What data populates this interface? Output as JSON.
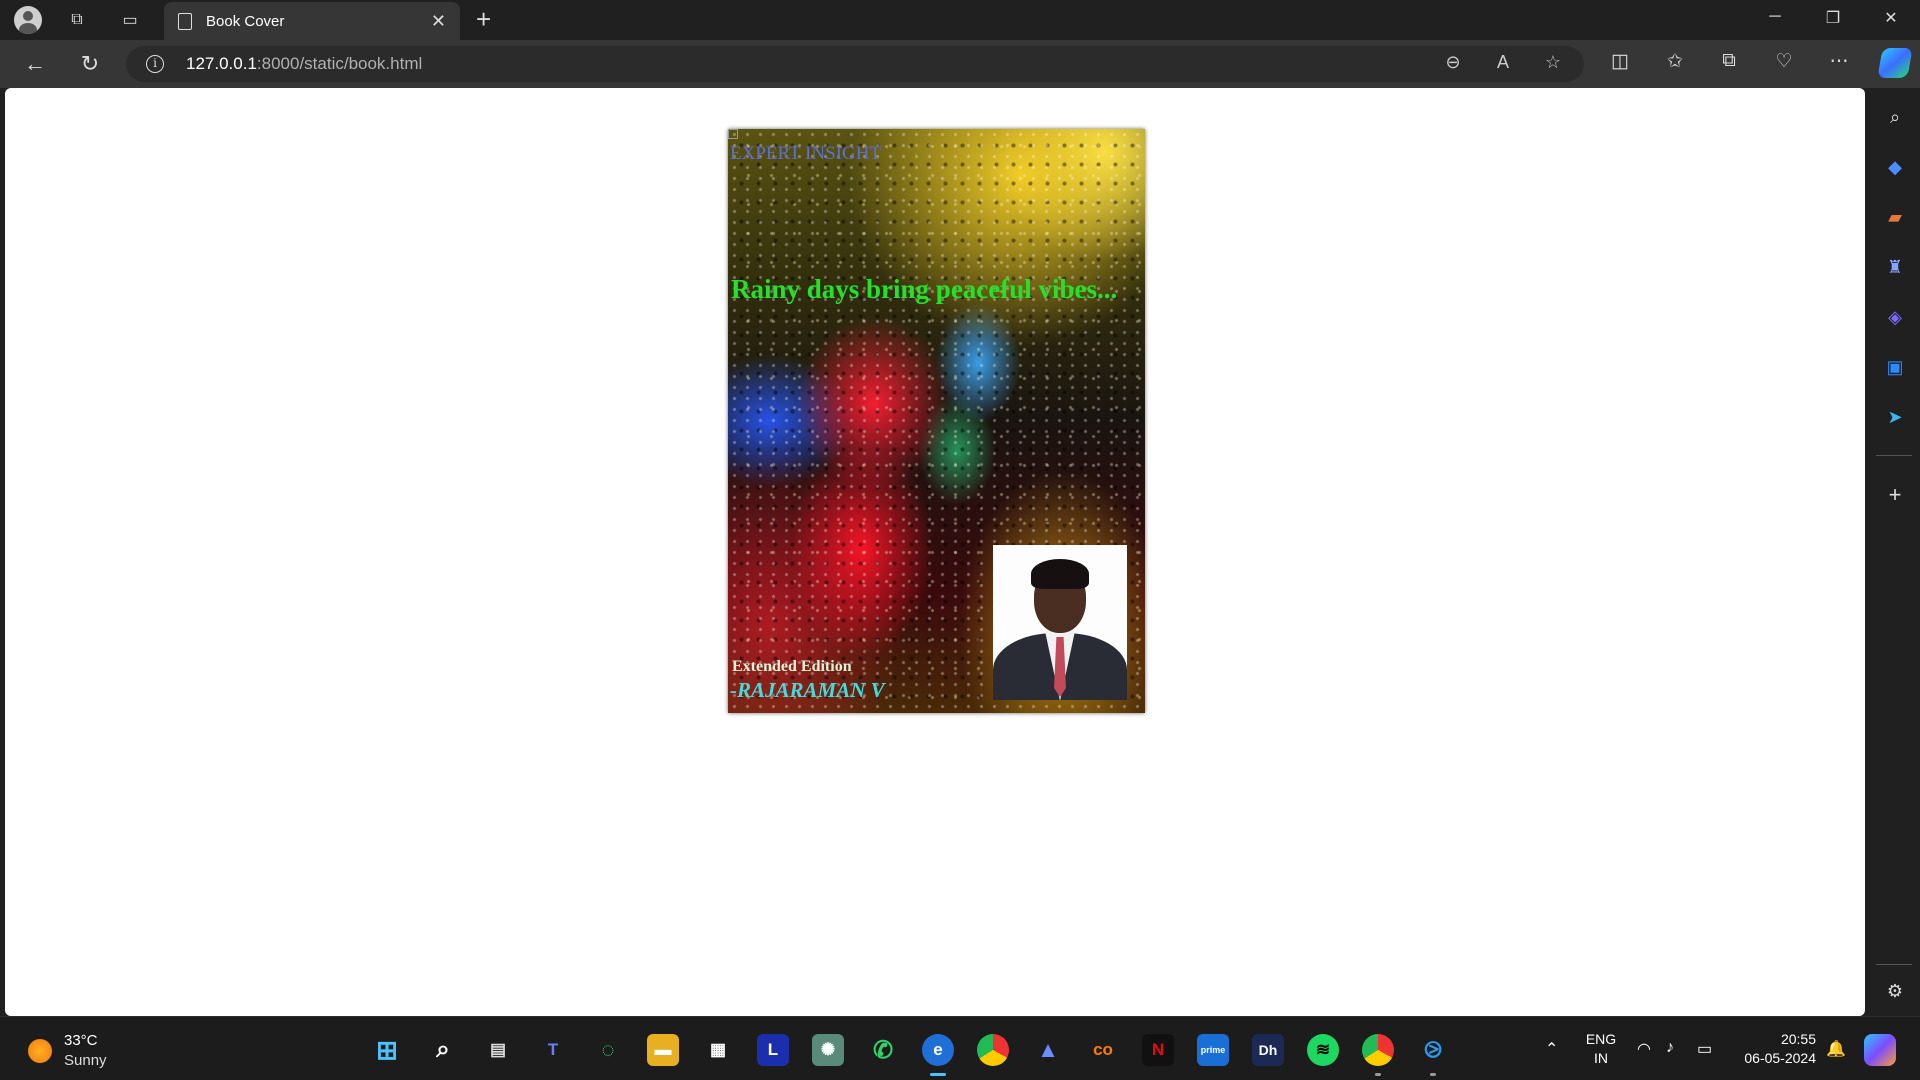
{
  "browser": {
    "tab_title": "Book Cover",
    "new_tab_label": "+",
    "url_host": "127.0.0.1",
    "url_path": ":8000/static/book.html"
  },
  "window_controls": {
    "minimize": "─",
    "restore": "❐",
    "close": "✕"
  },
  "nav": {
    "back": "←",
    "refresh": "↻"
  },
  "book_cover": {
    "publisher": "EXPERT INSIGHT",
    "tagline": "Rainy days bring peaceful vibes...",
    "edition": "Extended Edition",
    "author": "-RAJARAMAN V"
  },
  "taskbar": {
    "weather_temp": "33°C",
    "weather_condition": "Sunny",
    "lang_line1": "ENG",
    "lang_line2": "IN",
    "time": "20:55",
    "date": "06-05-2024"
  },
  "colors": {
    "tagline": "#22e22a",
    "publisher": "#5b6fd6",
    "author": "#3fdde0",
    "accent": "#4cc2ff"
  },
  "icons": {
    "titlebar": [
      "profile-icon",
      "workspaces-icon",
      "tab-actions-icon"
    ],
    "toolbar": [
      "zoom-out-icon",
      "read-aloud-icon",
      "favorite-star-icon",
      "split-screen-icon",
      "favorites-icon",
      "collections-icon",
      "browser-essentials-icon",
      "more-icon",
      "copilot-icon"
    ],
    "sidebar": [
      "search-icon",
      "shopping-icon",
      "tools-icon",
      "games-icon",
      "microsoft-365-icon",
      "outlook-icon",
      "telegram-icon",
      "add-icon",
      "settings-icon"
    ],
    "taskbar_apps": [
      "start-icon",
      "search-icon",
      "task-view-icon",
      "teams-icon",
      "copilot-ring-icon",
      "file-explorer-icon",
      "store-icon",
      "l-app-icon",
      "chatgpt-icon",
      "whatsapp-icon",
      "edge-icon",
      "chrome-icon",
      "alpha-app-icon",
      "coursera-icon",
      "netflix-icon",
      "prime-video-icon",
      "dh-app-icon",
      "spotify-icon",
      "chrome-alt-icon",
      "vscode-icon"
    ]
  }
}
